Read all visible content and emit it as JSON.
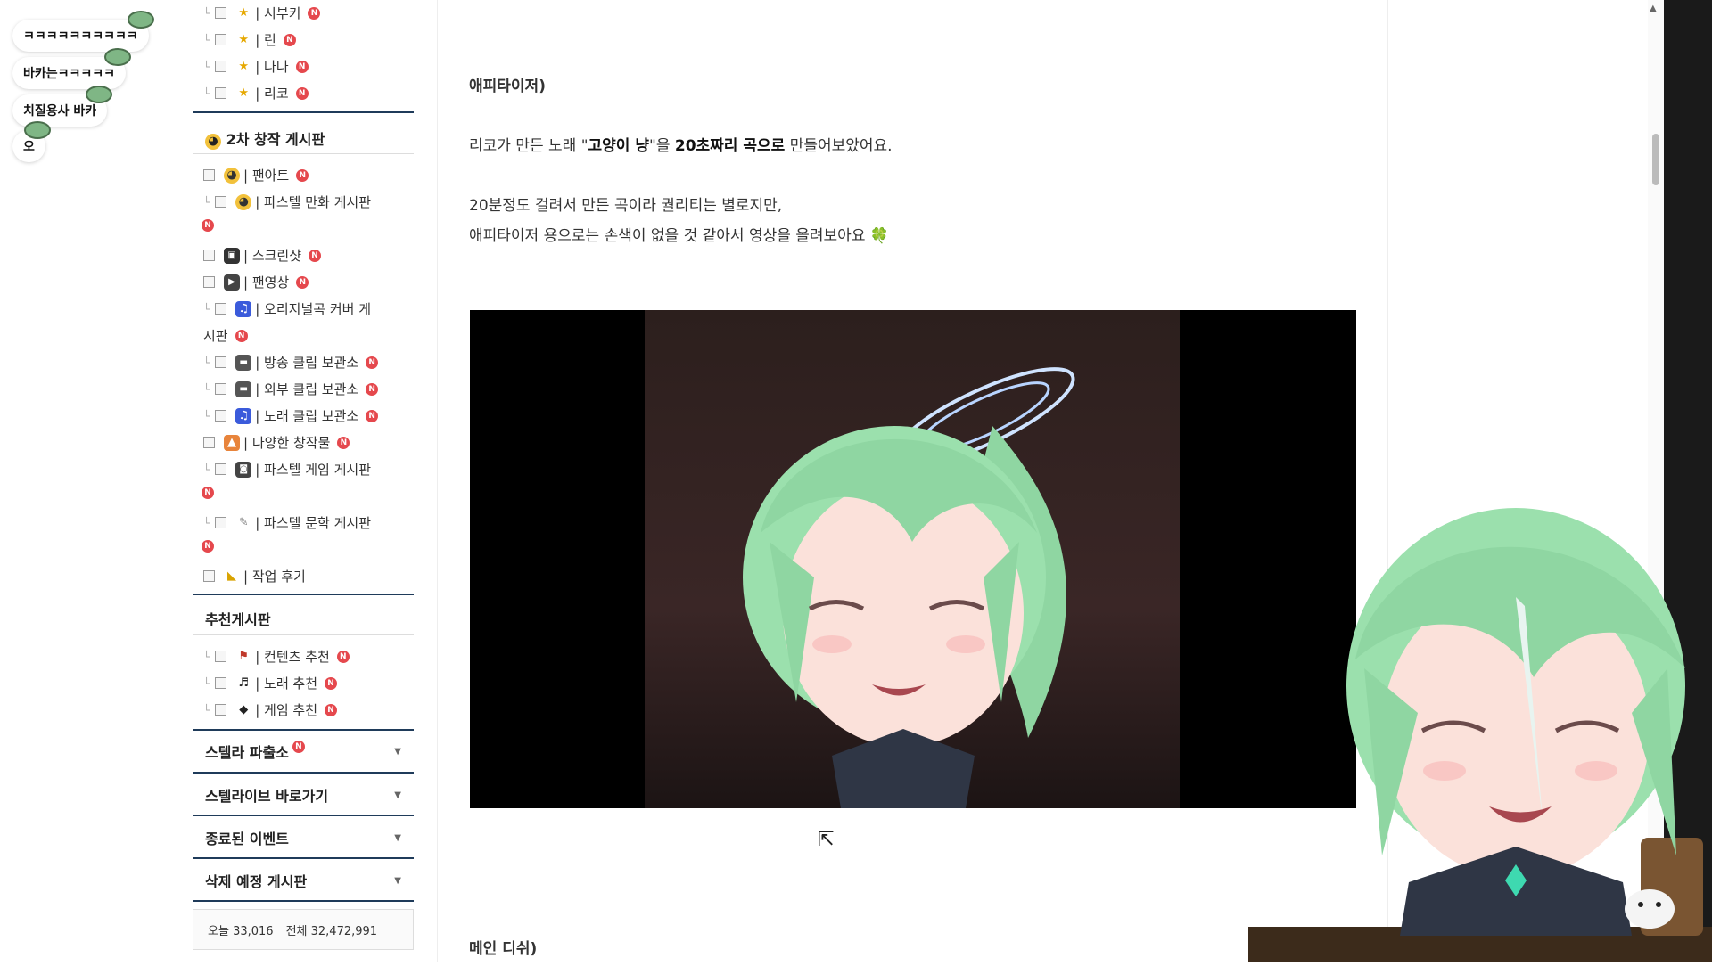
{
  "chat": {
    "messages": [
      "ㅋㅋㅋㅋㅋㅋㅋㅋㅋㅋ",
      "바카는ㅋㅋㅋㅋㅋ",
      "치질용사 바카",
      "오"
    ]
  },
  "sidebar": {
    "top_items": [
      {
        "label": "| 시부키",
        "icon": "star-icon"
      },
      {
        "label": "| 린",
        "icon": "star-icon"
      },
      {
        "label": "| 나나",
        "icon": "star-icon"
      },
      {
        "label": "| 리코",
        "icon": "star-icon"
      }
    ],
    "section2_title": "2차 창작 게시판",
    "section2_items": [
      {
        "label": "| 팬아트"
      },
      {
        "label": "| 파스텔 만화 게시판"
      },
      {
        "label": "| 스크린샷"
      },
      {
        "label": "| 팬영상"
      },
      {
        "label": "| 오리지널곡 커버 게",
        "label2": "시판"
      },
      {
        "label": "| 방송 클립 보관소"
      },
      {
        "label": "| 외부 클립 보관소"
      },
      {
        "label": "| 노래 클립 보관소"
      },
      {
        "label": "| 다양한 창작물"
      },
      {
        "label": "| 파스텔 게임 게시판"
      },
      {
        "label": "| 파스텔 문학 게시판"
      },
      {
        "label": "| 작업 후기"
      }
    ],
    "section3_title": "추천게시판",
    "section3_items": [
      {
        "label": "| 컨텐츠 추천"
      },
      {
        "label": "| 노래 추천"
      },
      {
        "label": "| 게임 추천"
      }
    ],
    "accordions": [
      "스텔라 파출소",
      "스텔라이브 바로가기",
      "종료된 이벤트",
      "삭제 예정 게시판"
    ],
    "new_badge": "N",
    "stats": {
      "today_label": "오늘",
      "today": "33,016",
      "total_label": "전체",
      "total": "32,472,991"
    }
  },
  "article": {
    "heading1": "애피타이저)",
    "line1_pre": "리코가 만든 노래 \"",
    "line1_bold1": "고양이 냥",
    "line1_mid": "\"을 ",
    "line1_bold2": "20초짜리 곡으로",
    "line1_post": " 만들어보았어요.",
    "line2": "20분정도 걸려서 만든 곡이라 퀄리티는 별로지만,",
    "line3": "애피타이저 용으로는 손색이 없을 것 같아서 영상을 올려보아요 🍀",
    "heading2": "메인 디쉬)"
  },
  "colors": {
    "accent_line": "#1f3b5a",
    "new_badge": "#e5484d"
  }
}
